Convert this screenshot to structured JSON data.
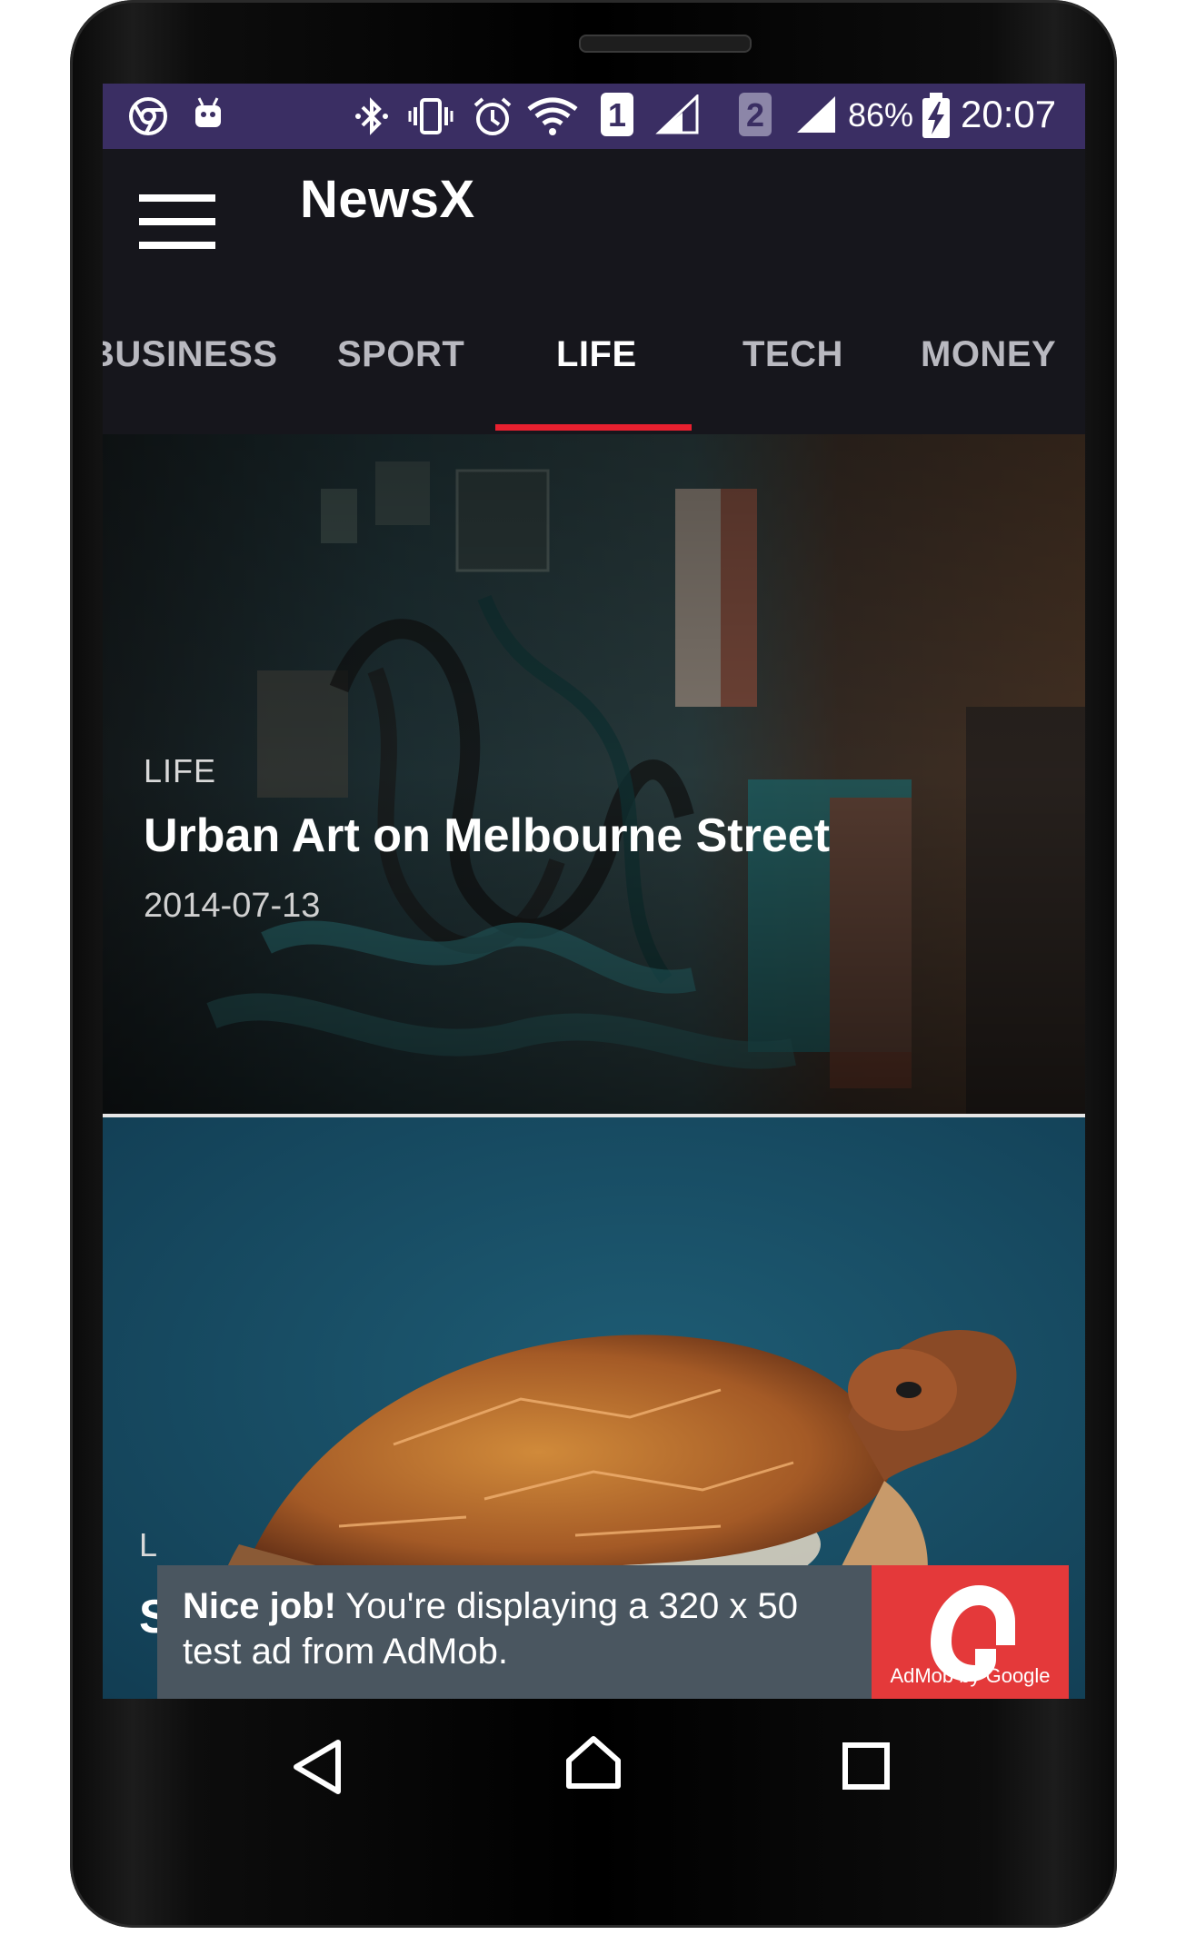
{
  "status_bar": {
    "battery_percent": "86%",
    "time": "20:07",
    "sim1_label": "1",
    "sim2_label": "2",
    "icons": [
      "chrome-icon",
      "android-icon",
      "bluetooth-icon",
      "vibrate-icon",
      "alarm-icon",
      "wifi-icon",
      "sim1-icon",
      "signal-icon",
      "sim2-icon",
      "signal-icon",
      "battery-charging-icon"
    ]
  },
  "toolbar": {
    "title": "NewsX",
    "menu_icon": "hamburger-menu-icon"
  },
  "tabs": {
    "items": [
      {
        "label": "BUSINESS"
      },
      {
        "label": "SPORT"
      },
      {
        "label": "LIFE"
      },
      {
        "label": "TECH"
      },
      {
        "label": "MONEY"
      }
    ],
    "active_index": 2
  },
  "articles": [
    {
      "category": "LIFE",
      "title": "Urban Art on Melbourne Street",
      "date": "2014-07-13",
      "image": "graffiti-wall-photo"
    },
    {
      "category": "L",
      "title": "S",
      "image": "sea-turtle-photo"
    }
  ],
  "ad": {
    "bold_text": "Nice job!",
    "text": " You're displaying a 320 x 50 test ad from AdMob.",
    "brand": "AdMob by Google"
  },
  "navbar": {
    "icons": [
      "back-icon",
      "home-icon",
      "recents-icon"
    ]
  },
  "colors": {
    "status_bar": "#3a2e63",
    "toolbar": "#16161c",
    "tab_indicator": "#e8202f",
    "ad_background": "#4a5660",
    "ad_logo": "#e4393a"
  }
}
